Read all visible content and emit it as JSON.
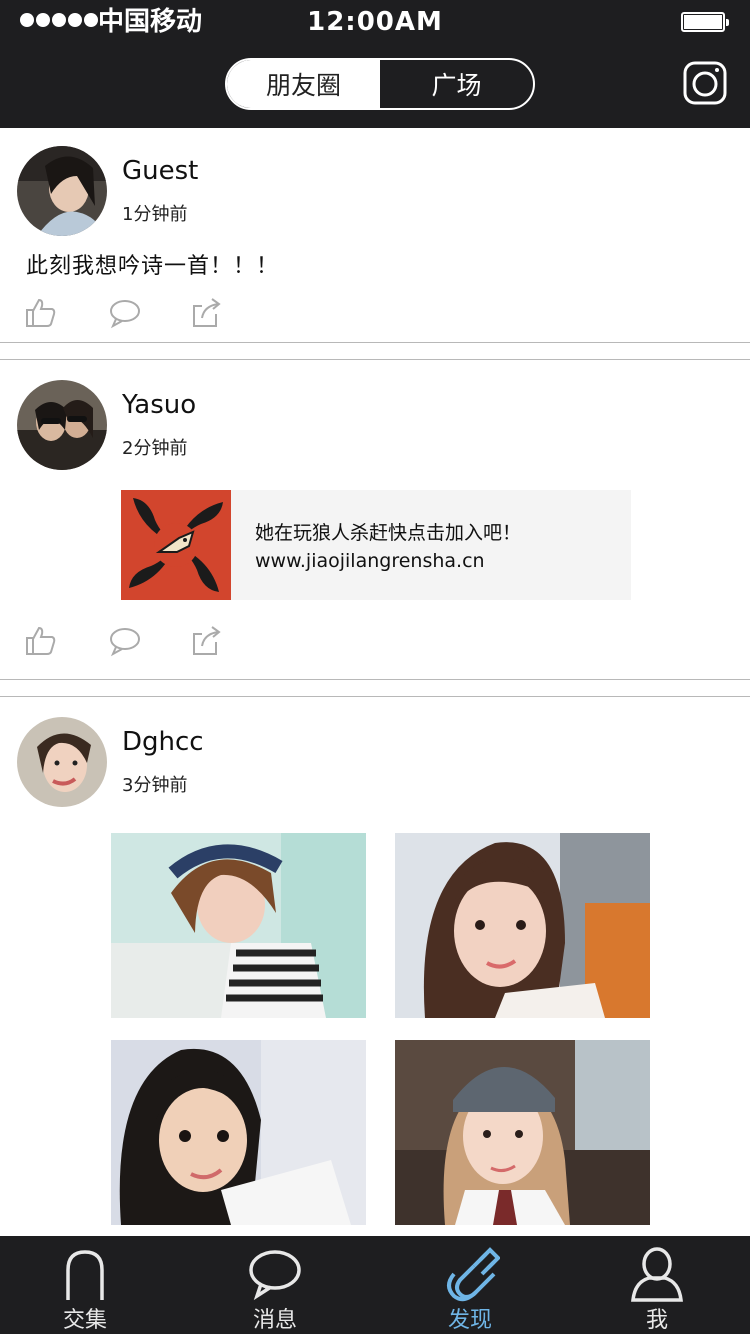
{
  "status_bar": {
    "carrier": "中国移动",
    "time": "12:00AM"
  },
  "header": {
    "tabs": [
      {
        "label": "朋友圈",
        "active": true
      },
      {
        "label": "广场",
        "active": false
      }
    ],
    "camera_icon": "camera-icon"
  },
  "posts": [
    {
      "username": "Guest",
      "time": "1分钟前",
      "text": "此刻我想吟诗一首！！！",
      "actions": [
        "like-icon",
        "comment-icon",
        "share-icon"
      ]
    },
    {
      "username": "Yasuo",
      "time": "2分钟前",
      "link": {
        "title": "她在玩狼人杀赶快点击加入吧！",
        "url": "www.jiaojilangrensha.cn"
      },
      "actions": [
        "like-icon",
        "comment-icon",
        "share-icon"
      ]
    },
    {
      "username": "Dghcc",
      "time": "3分钟前",
      "photos": [
        "photo-1",
        "photo-2",
        "photo-3",
        "photo-4"
      ]
    }
  ],
  "tabbar": {
    "items": [
      {
        "label": "交集",
        "icon": "arch-icon",
        "active": false
      },
      {
        "label": "消息",
        "icon": "chat-bubble-icon",
        "active": false
      },
      {
        "label": "发现",
        "icon": "magnet-icon",
        "active": true
      },
      {
        "label": "我",
        "icon": "person-icon",
        "active": false
      }
    ]
  },
  "colors": {
    "header_bg": "#1e1e20",
    "active_tab": "#6fb5e6",
    "divider": "#b8b8b8",
    "link_card_bg": "#f4f4f4"
  }
}
